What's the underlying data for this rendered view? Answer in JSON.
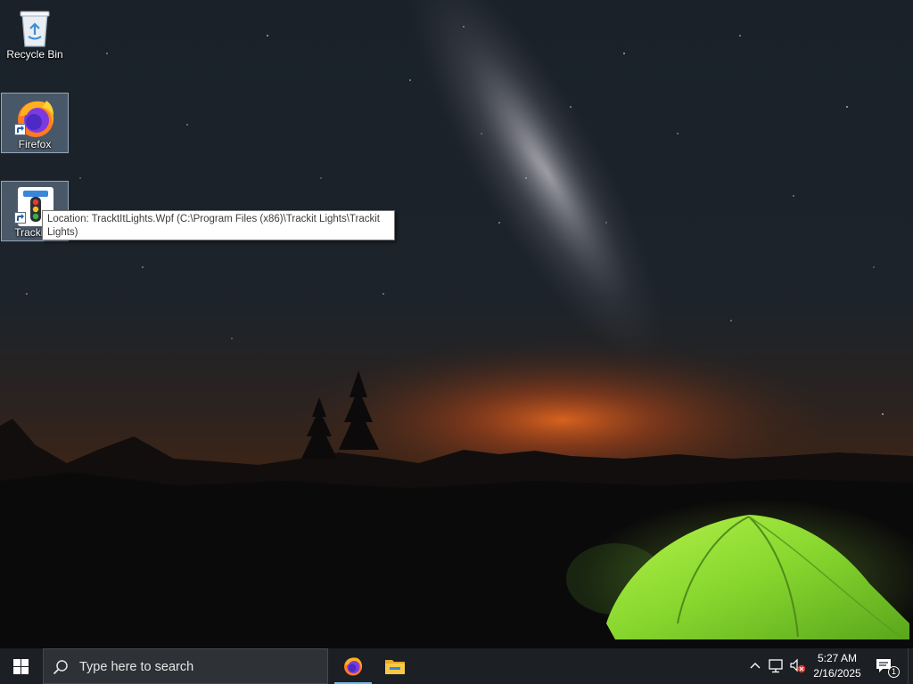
{
  "desktop": {
    "icons": [
      {
        "label": "Recycle Bin",
        "icon": "recycle-bin-icon"
      },
      {
        "label": "Firefox",
        "icon": "firefox-icon",
        "shortcut": true
      },
      {
        "label": "Trackit L",
        "icon": "trackit-lights-icon",
        "shortcut": true
      }
    ],
    "tooltip": {
      "line1": "Location: TracktItLights.Wpf (C:\\Program Files (x86)\\Trackit Lights\\Trackit",
      "line2": "Lights)"
    }
  },
  "taskbar": {
    "start_icon": "windows-logo-icon",
    "search_placeholder": "Type here to search",
    "pinned_apps": [
      {
        "name": "Firefox",
        "icon": "firefox-icon",
        "active": true
      },
      {
        "name": "File Explorer",
        "icon": "file-explorer-icon",
        "active": false
      }
    ],
    "tray": {
      "icons": [
        "chevron-up-icon",
        "network-icon",
        "volume-muted-icon"
      ],
      "time": "5:27 AM",
      "date": "2/16/2025",
      "notification_count": "1"
    }
  },
  "colors": {
    "taskbar_bg": "#1c1f24",
    "accent": "#76b9ed",
    "tent_green": "#8fe83a",
    "horizon_orange": "#d9561c"
  }
}
